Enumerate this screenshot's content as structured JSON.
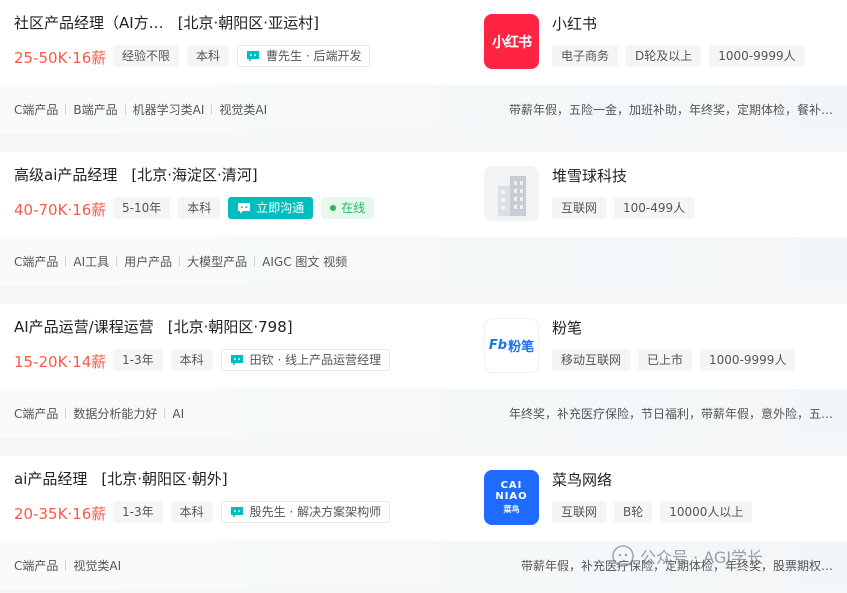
{
  "jobs": [
    {
      "title": "社区产品经理（AI方…",
      "location": "[北京·朝阳区·亚运村]",
      "salary": "25-50K·16薪",
      "requirements": [
        "经验不限",
        "本科"
      ],
      "recruiter": "曹先生 · 后端开发",
      "skills": [
        "C端产品",
        "B端产品",
        "机器学习类AI",
        "视觉类AI"
      ],
      "welfare": "带薪年假，五险一金，加班补助，年终奖，定期体检，餐补…",
      "company": {
        "name": "小红书",
        "logo_text": "小红书",
        "logo_type": "xhs",
        "tags": [
          "电子商务",
          "D轮及以上",
          "1000-9999人"
        ]
      }
    },
    {
      "title": "高级ai产品经理",
      "location": "[北京·海淀区·清河]",
      "salary": "40-70K·16薪",
      "requirements": [
        "5-10年",
        "本科"
      ],
      "chat_button": "立即沟通",
      "online_badge": "在线",
      "skills": [
        "C端产品",
        "AI工具",
        "用户产品",
        "大模型产品",
        "AIGC 图文 视频"
      ],
      "welfare": "",
      "company": {
        "name": "堆雪球科技",
        "logo_type": "building-icon",
        "tags": [
          "互联网",
          "100-499人"
        ]
      }
    },
    {
      "title": "AI产品运营/课程运营",
      "location": "[北京·朝阳区·798]",
      "salary": "15-20K·14薪",
      "requirements": [
        "1-3年",
        "本科"
      ],
      "recruiter": "田钦 · 线上产品运营经理",
      "skills": [
        "C端产品",
        "数据分析能力好",
        "AI"
      ],
      "welfare": "年终奖，补充医疗保险，节日福利，带薪年假，意外险，五…",
      "company": {
        "name": "粉笔",
        "logo_text": "粉笔",
        "logo_prefix": "Fb",
        "logo_type": "fenbi",
        "tags": [
          "移动互联网",
          "已上市",
          "1000-9999人"
        ]
      }
    },
    {
      "title": "ai产品经理",
      "location": "[北京·朝阳区·朝外]",
      "salary": "20-35K·16薪",
      "requirements": [
        "1-3年",
        "本科"
      ],
      "recruiter": "殷先生 · 解决方案架构师",
      "skills": [
        "C端产品",
        "视觉类AI"
      ],
      "welfare": "带薪年假，补充医疗保险，定期体检，年终奖，股票期权…",
      "company": {
        "name": "菜鸟网络",
        "logo_line1": "CAI",
        "logo_line2": "NIAO",
        "logo_sub": "菜鸟",
        "logo_type": "cainiao",
        "tags": [
          "互联网",
          "B轮",
          "10000人以上"
        ]
      }
    }
  ],
  "watermark": "公众号 · AGI学长",
  "colors": {
    "salary": "#fe574a",
    "accent": "#00bebd",
    "online": "#2cb463",
    "xhs": "#ff2442",
    "cainiao": "#1f6bff",
    "fenbi": "#1e6ff1"
  }
}
